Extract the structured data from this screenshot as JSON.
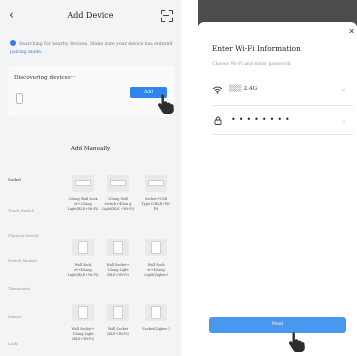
{
  "left_screen": {
    "header": {
      "back_icon": "chevron-left-icon",
      "title": "Add Device",
      "scan_icon": "scan-icon"
    },
    "notice": {
      "text": "Searching for nearby devices. Make sure your device has entered ",
      "link": "pairing mode",
      "suffix": "."
    },
    "discovering": {
      "label": "Discovering devices···",
      "add_button": "Add"
    },
    "manual_title": "Add Manually",
    "categories": [
      "Socket",
      "Touch Switch",
      "Physical Switch",
      "Switch Module",
      "Thermostat",
      "Sensor",
      "Lock"
    ],
    "active_category": "Socket",
    "row1": [
      "2Gang Wall Sock et+2Gang Light(BLE+Wi-Fi)",
      "2Gang Wall Switch+4Gan g Light(BLE +Wi-Fi)",
      "Socket+USB Type-C(BLE+Wi-Fi)"
    ],
    "row2": [
      "Wall Sock et+4Gang Light(BLE+Wi-Fi)",
      "Wall Socket+ 2Gang Light (BLE+Wi-Fi)",
      "Wall Sock et+4Gang Light(Zigbee)"
    ],
    "row3": [
      "Wall Socket+ 1Gang Light (BLE+Wi-Fi)",
      "Wall Socket (BLE+Wi-Fi)",
      "Socket(Zigbee )"
    ]
  },
  "right_screen": {
    "close_icon": "close-icon",
    "title": "Enter Wi-Fi Information",
    "subtitle": "Choose Wi-Fi and enter password",
    "ssid": "░░░ 2.4G",
    "password_mask": "••••••••",
    "next_button": "Next",
    "accent": "#4a97f0"
  }
}
